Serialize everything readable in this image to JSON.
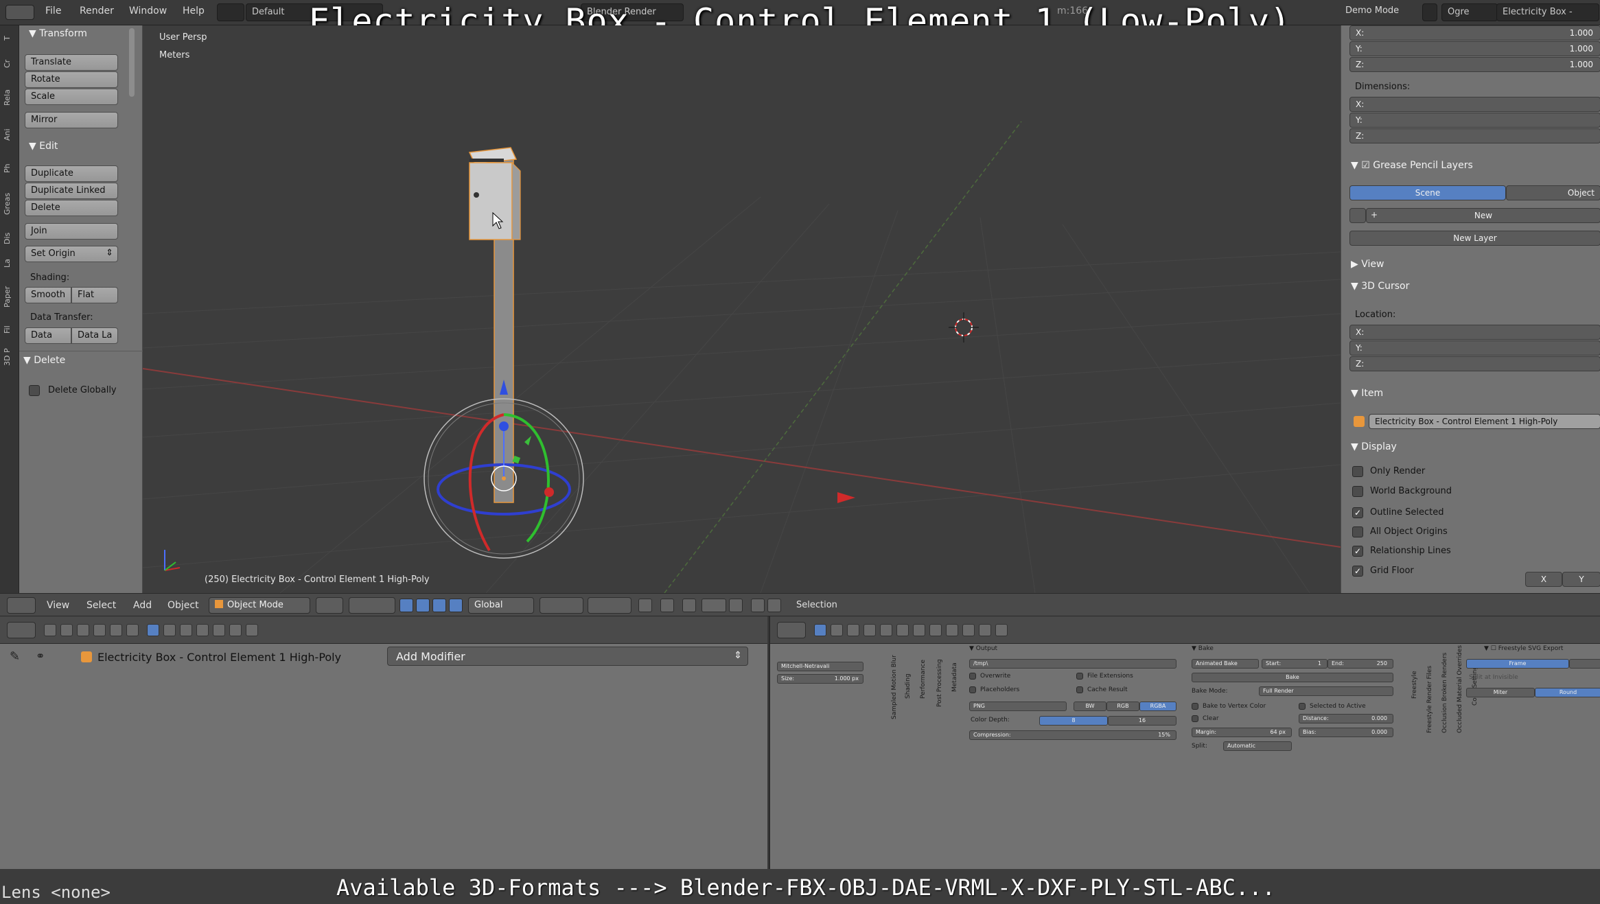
{
  "overlay": {
    "title": "Electricity Box - Control Element 1 (Low-Poly)",
    "formats_caption": "Available 3D-Formats ---> Blender-FBX-OBJ-DAE-VRML-X-DXF-PLY-STL-ABC...",
    "lens": "Lens <none>"
  },
  "topbar": {
    "menus": [
      "File",
      "Render",
      "Window",
      "Help"
    ],
    "layout": "Default",
    "engine": "Blender Render",
    "stats_fragment": "m:166",
    "demo_mode": "Demo Mode",
    "ogre": "Ogre",
    "scene_object": "Electricity Box -"
  },
  "left_tabs": [
    "T",
    "Cr",
    "Rela",
    "Ani",
    "Ph",
    "Greas",
    "Dis",
    "La",
    "Paper",
    "Fil",
    "3D P"
  ],
  "toolshelf": {
    "transform_header": "Transform",
    "translate": "Translate",
    "rotate": "Rotate",
    "scale": "Scale",
    "mirror": "Mirror",
    "edit_header": "Edit",
    "duplicate": "Duplicate",
    "duplicate_linked": "Duplicate Linked",
    "delete": "Delete",
    "join": "Join",
    "set_origin": "Set Origin",
    "shading_label": "Shading:",
    "smooth": "Smooth",
    "flat": "Flat",
    "data_transfer_label": "Data Transfer:",
    "data": "Data",
    "data_la": "Data La",
    "delete_header": "Delete",
    "delete_globally": "Delete Globally"
  },
  "viewport": {
    "view_name": "User Persp",
    "units": "Meters",
    "object_info": "(250) Electricity Box - Control Element 1 High-Poly"
  },
  "properties": {
    "scale": {
      "x": "1.000",
      "y": "1.000",
      "z": "1.000"
    },
    "dimensions_label": "Dimensions:",
    "grease_pencil_header": "Grease Pencil Layers",
    "scene_tab": "Scene",
    "object_tab": "Object",
    "new": "New",
    "new_layer": "New Layer",
    "view_header": "View",
    "cursor_header": "3D Cursor",
    "location_label": "Location:",
    "item_header": "Item",
    "item_name": "Electricity Box - Control Element 1 High-Poly",
    "display_header": "Display",
    "display_options": [
      {
        "label": "Only Render",
        "checked": false
      },
      {
        "label": "World Background",
        "checked": false
      },
      {
        "label": "Outline Selected",
        "checked": true
      },
      {
        "label": "All Object Origins",
        "checked": false
      },
      {
        "label": "Relationship Lines",
        "checked": true
      },
      {
        "label": "Grid Floor",
        "checked": true
      }
    ],
    "axis_x": "X",
    "axis_y": "Y",
    "x_label": "X:",
    "y_label": "Y:",
    "z_label": "Z:"
  },
  "view_header": {
    "menus": [
      "View",
      "Select",
      "Add",
      "Object"
    ],
    "mode": "Object Mode",
    "orientation": "Global",
    "selection": "Selection"
  },
  "modifiers": {
    "object_name": "Electricity Box - Control Element 1 High-Poly",
    "add_modifier": "Add Modifier"
  },
  "render_props": {
    "filter": "Mitchell-Netravali",
    "size": "Size:",
    "size_value": "1.000 px",
    "vertical_tabs": [
      "Sampled Motion Blur",
      "Shading",
      "Performance",
      "Post Processing",
      "Metadata"
    ],
    "output_header": "Output",
    "output_path": "/tmp\\",
    "overwrite": "Overwrite",
    "file_extensions": "File Extensions",
    "placeholders": "Placeholders",
    "cache_result": "Cache Result",
    "format": "PNG",
    "bw": "BW",
    "rgb": "RGB",
    "rgba": "RGBA",
    "color_depth": "Color Depth:",
    "depth_8": "8",
    "depth_16": "16",
    "compression": "Compression:",
    "compression_value": "15%",
    "bake_header": "Bake",
    "animated_bake": "Animated Bake",
    "start": "Start:",
    "start_value": "1",
    "end": "End:",
    "end_value": "250",
    "bake_button": "Bake",
    "bake_mode": "Bake Mode:",
    "bake_mode_value": "Full Render",
    "bake_vertex_color": "Bake to Vertex Color",
    "selected_to_active": "Selected to Active",
    "clear": "Clear",
    "distance": "Distance:",
    "distance_value": "0.000",
    "margin": "Margin:",
    "margin_value": "64 px",
    "bias": "Bias:",
    "bias_value": "0.000",
    "split": "Split:",
    "split_value": "Automatic",
    "vertical_tabs2": [
      "Freestyle",
      "Freestyle Render Files",
      "Occlusion Broken Renders",
      "Occluded Material Overrides",
      "Copy Settings"
    ],
    "freestyle_header": "Freestyle SVG Export",
    "frame": "Frame",
    "split_invisible": "Split at Invisible",
    "miter": "Miter",
    "round": "Round"
  }
}
